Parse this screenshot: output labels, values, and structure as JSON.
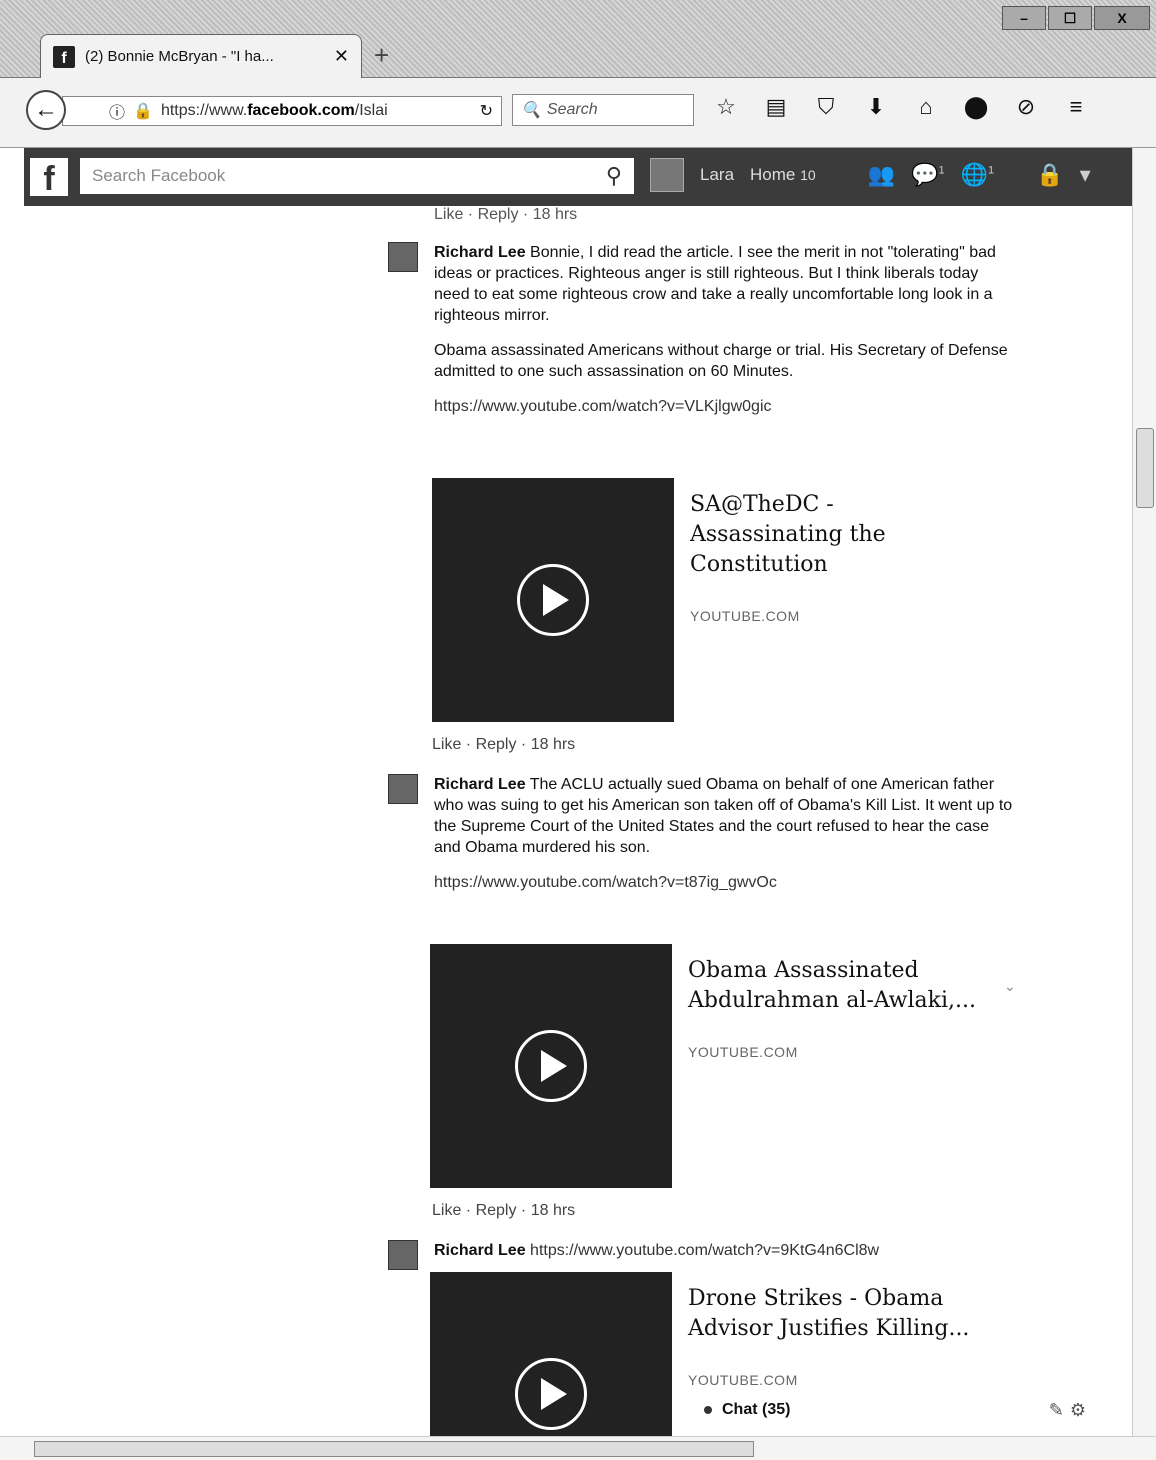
{
  "browser": {
    "tab_title": "(2) Bonnie McBryan - \"I ha...",
    "tab_close": "✕",
    "new_tab": "+",
    "url_prefix": "https://www.",
    "url_domain": "facebook.com",
    "url_suffix": "/Islai",
    "search_placeholder": "Search",
    "window_buttons": [
      "–",
      "☐",
      "X"
    ]
  },
  "facebook": {
    "logo": "f",
    "search_placeholder": "Search Facebook",
    "user_name": "Lara",
    "home_label": "Home",
    "home_count": "10",
    "messages_badge": "1",
    "notifications_badge": "1"
  },
  "previous_actions": "Like · Reply · 18 hrs",
  "comments": [
    {
      "author": "Richard Lee",
      "paragraphs": [
        "Bonnie, I did read the article. I see the merit in not \"tolerating\" bad ideas or practices. Righteous anger is still righteous. But I think liberals today need to eat some righteous crow and take a really uncomfortable long look in a righteous mirror.",
        "Obama assassinated Americans without charge or trial. His Secretary of Defense admitted to one such assassination on 60 Minutes."
      ],
      "link": "https://www.youtube.com/watch?v=VLKjlgw0gic",
      "preview_title": "SA@TheDC - Assassinating the Constitution",
      "preview_source": "YOUTUBE.COM",
      "actions": "Like · Reply · 18 hrs"
    },
    {
      "author": "Richard Lee",
      "paragraphs": [
        "The ACLU actually sued Obama on behalf of one American father who was suing to get his American son taken off of Obama's Kill List. It went up to the Supreme Court of the United States and the court refused to hear the case and Obama murdered his son."
      ],
      "link": "https://www.youtube.com/watch?v=t87ig_gwvOc",
      "preview_title": "Obama Assassinated Abdulrahman al-Awlaki,...",
      "preview_source": "YOUTUBE.COM",
      "actions": "Like · Reply · 18 hrs"
    },
    {
      "author": "Richard Lee",
      "link": "https://www.youtube.com/watch?v=9KtG4n6Cl8w",
      "preview_title": "Drone Strikes - Obama Advisor Justifies Killing...",
      "preview_source": "YOUTUBE.COM"
    }
  ],
  "chat": {
    "label": "Chat (35)"
  }
}
